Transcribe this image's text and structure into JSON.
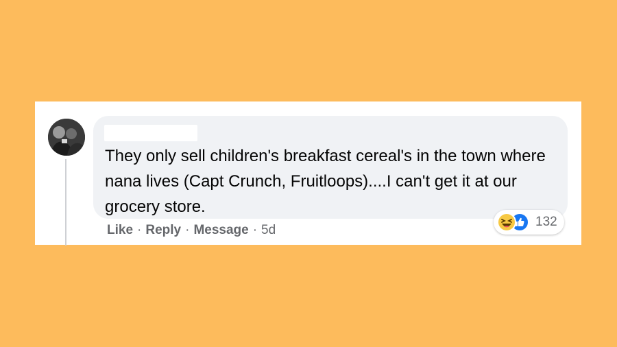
{
  "comment": {
    "author_redacted": true,
    "text": "They only sell children's breakfast cereal's in the town where nana lives (Capt Crunch, Fruitloops)....I can't get it at our grocery store."
  },
  "reactions": {
    "icons": [
      "haha-icon",
      "like-icon"
    ],
    "count": "132"
  },
  "actions": {
    "like": "Like",
    "reply": "Reply",
    "message": "Message",
    "time": "5d",
    "separator": "·"
  },
  "colors": {
    "background": "#FDBB5C",
    "bubble": "#F0F2F5",
    "meta_text": "#65676B",
    "like_blue": "#1877F2",
    "haha_yellow": "#F7C944"
  }
}
